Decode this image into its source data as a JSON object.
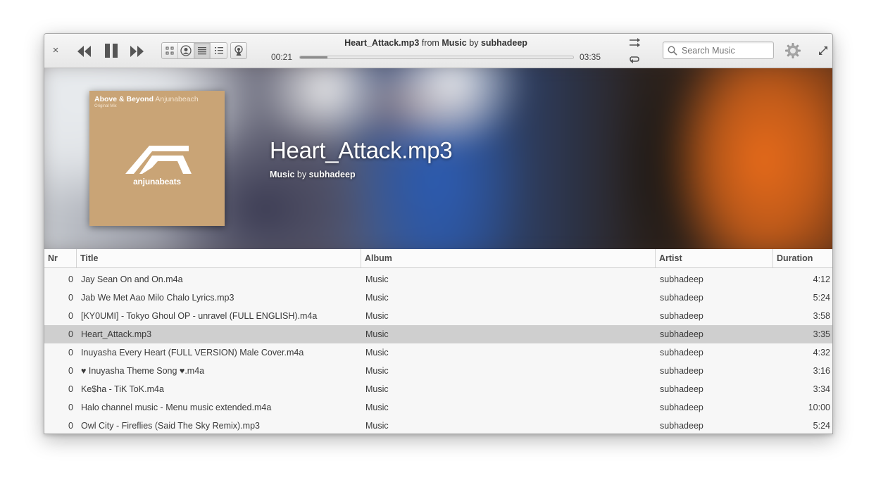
{
  "header": {
    "now_playing": {
      "track": "Heart_Attack.mp3",
      "from_word": "from",
      "album": "Music",
      "by_word": "by",
      "artist": "subhadeep"
    },
    "time_current": "00:21",
    "time_total": "03:35",
    "progress_fraction": 0.1,
    "search": {
      "placeholder": "Search Music"
    },
    "close_glyph": "×"
  },
  "banner": {
    "title": "Heart_Attack.mp3",
    "album": "Music",
    "by_word": "by",
    "artist": "subhadeep",
    "art": {
      "artist": "Above & Beyond",
      "label_name": "Anjunabeach",
      "mix": "Original Mix",
      "label": "anjunabeats",
      "color": "#c9a476"
    }
  },
  "table": {
    "columns": {
      "nr": "Nr",
      "title": "Title",
      "album": "Album",
      "artist": "Artist",
      "duration": "Duration"
    },
    "rows": [
      {
        "nr": "0",
        "title": "Jay Sean On and On.m4a",
        "album": "Music",
        "artist": "subhadeep",
        "duration": "4:12"
      },
      {
        "nr": "0",
        "title": "Jab We Met Aao Milo Chalo Lyrics.mp3",
        "album": "Music",
        "artist": "subhadeep",
        "duration": "5:24"
      },
      {
        "nr": "0",
        "title": "[KY0UMI] - Tokyo Ghoul OP - unravel (FULL ENGLISH).m4a",
        "album": "Music",
        "artist": "subhadeep",
        "duration": "3:58"
      },
      {
        "nr": "0",
        "title": "Heart_Attack.mp3",
        "album": "Music",
        "artist": "subhadeep",
        "duration": "3:35"
      },
      {
        "nr": "0",
        "title": "Inuyasha Every Heart (FULL VERSION) Male Cover.m4a",
        "album": "Music",
        "artist": "subhadeep",
        "duration": "4:32"
      },
      {
        "nr": "0",
        "title": "♥ Inuyasha Theme Song ♥.m4a",
        "album": "Music",
        "artist": "subhadeep",
        "duration": "3:16"
      },
      {
        "nr": "0",
        "title": "Ke$ha - TiK ToK.m4a",
        "album": "Music",
        "artist": "subhadeep",
        "duration": "3:34"
      },
      {
        "nr": "0",
        "title": "Halo channel music - Menu music extended.m4a",
        "album": "Music",
        "artist": "subhadeep",
        "duration": "10:00"
      },
      {
        "nr": "0",
        "title": "Owl City - Fireflies (Said The Sky Remix).mp3",
        "album": "Music",
        "artist": "subhadeep",
        "duration": "5:24"
      }
    ],
    "selected_index": 3
  },
  "icons": [
    "close-icon",
    "previous-icon",
    "pause-icon",
    "next-icon",
    "grid-view-icon",
    "artist-view-icon",
    "list-view-icon",
    "column-view-icon",
    "radio-icon",
    "shuffle-icon",
    "repeat-icon",
    "search-icon",
    "gear-icon",
    "maximize-icon"
  ],
  "colors": {
    "selected_row": "#cfcfcf",
    "banner_accent_orange": "#e86b1a",
    "banner_accent_blue": "#2c5bb0"
  }
}
